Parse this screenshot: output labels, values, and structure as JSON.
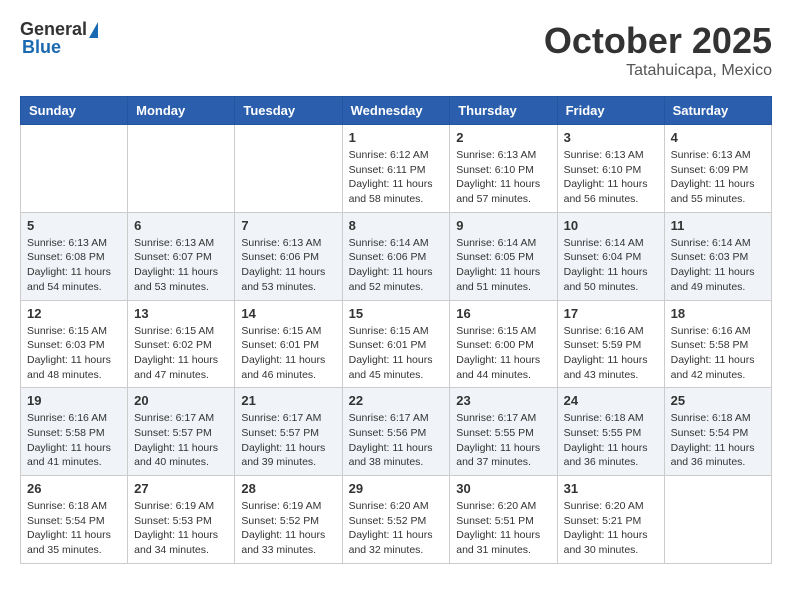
{
  "header": {
    "logo_general": "General",
    "logo_blue": "Blue",
    "month": "October 2025",
    "location": "Tatahuicapa, Mexico"
  },
  "weekdays": [
    "Sunday",
    "Monday",
    "Tuesday",
    "Wednesday",
    "Thursday",
    "Friday",
    "Saturday"
  ],
  "weeks": [
    [
      {
        "day": "",
        "info": ""
      },
      {
        "day": "",
        "info": ""
      },
      {
        "day": "",
        "info": ""
      },
      {
        "day": "1",
        "info": "Sunrise: 6:12 AM\nSunset: 6:11 PM\nDaylight: 11 hours and 58 minutes."
      },
      {
        "day": "2",
        "info": "Sunrise: 6:13 AM\nSunset: 6:10 PM\nDaylight: 11 hours and 57 minutes."
      },
      {
        "day": "3",
        "info": "Sunrise: 6:13 AM\nSunset: 6:10 PM\nDaylight: 11 hours and 56 minutes."
      },
      {
        "day": "4",
        "info": "Sunrise: 6:13 AM\nSunset: 6:09 PM\nDaylight: 11 hours and 55 minutes."
      }
    ],
    [
      {
        "day": "5",
        "info": "Sunrise: 6:13 AM\nSunset: 6:08 PM\nDaylight: 11 hours and 54 minutes."
      },
      {
        "day": "6",
        "info": "Sunrise: 6:13 AM\nSunset: 6:07 PM\nDaylight: 11 hours and 53 minutes."
      },
      {
        "day": "7",
        "info": "Sunrise: 6:13 AM\nSunset: 6:06 PM\nDaylight: 11 hours and 53 minutes."
      },
      {
        "day": "8",
        "info": "Sunrise: 6:14 AM\nSunset: 6:06 PM\nDaylight: 11 hours and 52 minutes."
      },
      {
        "day": "9",
        "info": "Sunrise: 6:14 AM\nSunset: 6:05 PM\nDaylight: 11 hours and 51 minutes."
      },
      {
        "day": "10",
        "info": "Sunrise: 6:14 AM\nSunset: 6:04 PM\nDaylight: 11 hours and 50 minutes."
      },
      {
        "day": "11",
        "info": "Sunrise: 6:14 AM\nSunset: 6:03 PM\nDaylight: 11 hours and 49 minutes."
      }
    ],
    [
      {
        "day": "12",
        "info": "Sunrise: 6:15 AM\nSunset: 6:03 PM\nDaylight: 11 hours and 48 minutes."
      },
      {
        "day": "13",
        "info": "Sunrise: 6:15 AM\nSunset: 6:02 PM\nDaylight: 11 hours and 47 minutes."
      },
      {
        "day": "14",
        "info": "Sunrise: 6:15 AM\nSunset: 6:01 PM\nDaylight: 11 hours and 46 minutes."
      },
      {
        "day": "15",
        "info": "Sunrise: 6:15 AM\nSunset: 6:01 PM\nDaylight: 11 hours and 45 minutes."
      },
      {
        "day": "16",
        "info": "Sunrise: 6:15 AM\nSunset: 6:00 PM\nDaylight: 11 hours and 44 minutes."
      },
      {
        "day": "17",
        "info": "Sunrise: 6:16 AM\nSunset: 5:59 PM\nDaylight: 11 hours and 43 minutes."
      },
      {
        "day": "18",
        "info": "Sunrise: 6:16 AM\nSunset: 5:58 PM\nDaylight: 11 hours and 42 minutes."
      }
    ],
    [
      {
        "day": "19",
        "info": "Sunrise: 6:16 AM\nSunset: 5:58 PM\nDaylight: 11 hours and 41 minutes."
      },
      {
        "day": "20",
        "info": "Sunrise: 6:17 AM\nSunset: 5:57 PM\nDaylight: 11 hours and 40 minutes."
      },
      {
        "day": "21",
        "info": "Sunrise: 6:17 AM\nSunset: 5:57 PM\nDaylight: 11 hours and 39 minutes."
      },
      {
        "day": "22",
        "info": "Sunrise: 6:17 AM\nSunset: 5:56 PM\nDaylight: 11 hours and 38 minutes."
      },
      {
        "day": "23",
        "info": "Sunrise: 6:17 AM\nSunset: 5:55 PM\nDaylight: 11 hours and 37 minutes."
      },
      {
        "day": "24",
        "info": "Sunrise: 6:18 AM\nSunset: 5:55 PM\nDaylight: 11 hours and 36 minutes."
      },
      {
        "day": "25",
        "info": "Sunrise: 6:18 AM\nSunset: 5:54 PM\nDaylight: 11 hours and 36 minutes."
      }
    ],
    [
      {
        "day": "26",
        "info": "Sunrise: 6:18 AM\nSunset: 5:54 PM\nDaylight: 11 hours and 35 minutes."
      },
      {
        "day": "27",
        "info": "Sunrise: 6:19 AM\nSunset: 5:53 PM\nDaylight: 11 hours and 34 minutes."
      },
      {
        "day": "28",
        "info": "Sunrise: 6:19 AM\nSunset: 5:52 PM\nDaylight: 11 hours and 33 minutes."
      },
      {
        "day": "29",
        "info": "Sunrise: 6:20 AM\nSunset: 5:52 PM\nDaylight: 11 hours and 32 minutes."
      },
      {
        "day": "30",
        "info": "Sunrise: 6:20 AM\nSunset: 5:51 PM\nDaylight: 11 hours and 31 minutes."
      },
      {
        "day": "31",
        "info": "Sunrise: 6:20 AM\nSunset: 5:21 PM\nDaylight: 11 hours and 30 minutes."
      },
      {
        "day": "",
        "info": ""
      }
    ]
  ]
}
